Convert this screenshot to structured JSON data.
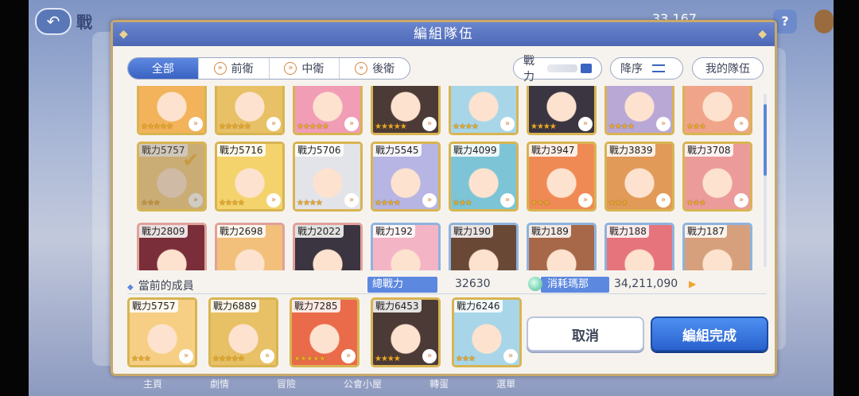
{
  "background": {
    "title": "戰",
    "power_display": "33,167",
    "help_label": "?",
    "menu_label": "",
    "bottom_nav": [
      "主頁",
      "劇情",
      "冒險",
      "公會小屋",
      "轉蛋",
      "選單"
    ]
  },
  "dialog": {
    "title": "編組隊伍",
    "tabs": [
      {
        "label": "全部",
        "active": true
      },
      {
        "label": "前衛",
        "active": false
      },
      {
        "label": "中衛",
        "active": false
      },
      {
        "label": "後衛",
        "active": false
      }
    ],
    "filter_power_label": "戰力",
    "sort_label": "降序",
    "my_team_label": "我的隊伍",
    "grid": {
      "row1": [
        {
          "name": "",
          "stars": "★★★★★",
          "rank": "»",
          "portrait": "#f2b35b"
        },
        {
          "name": "",
          "stars": "★★★★★",
          "rank": "»",
          "portrait": "#e8c065"
        },
        {
          "name": "",
          "stars": "★★★★★",
          "rank": "»",
          "portrait": "#f19db6"
        },
        {
          "name": "",
          "stars": "★★★★★",
          "rank": "»",
          "portrait": "#4b3a35"
        },
        {
          "name": "",
          "stars": "★★★★",
          "rank": "»",
          "portrait": "#a8d6e8"
        },
        {
          "name": "",
          "stars": "★★★★",
          "rank": "»",
          "portrait": "#3a3540"
        },
        {
          "name": "",
          "stars": "★★★★",
          "rank": "»",
          "portrait": "#b9a8d6"
        },
        {
          "name": "",
          "stars": "★★★",
          "rank": "»",
          "portrait": "#f0a58a"
        }
      ],
      "row2": [
        {
          "power": "戰力5757",
          "stars": "★★★",
          "rank": "»",
          "portrait": "#f6cf85",
          "selected": true
        },
        {
          "power": "戰力5716",
          "stars": "★★★★",
          "rank": "»",
          "portrait": "#f4d36c"
        },
        {
          "power": "戰力5706",
          "stars": "★★★★",
          "rank": "»",
          "portrait": "#e3e3ea"
        },
        {
          "power": "戰力5545",
          "stars": "★★★★",
          "rank": "»",
          "portrait": "#b7b5e3"
        },
        {
          "power": "戰力4099",
          "stars": "★★★",
          "rank": "»",
          "portrait": "#7dc5d6"
        },
        {
          "power": "戰力3947",
          "stars": "★★★",
          "rank": "»",
          "portrait": "#f08a55"
        },
        {
          "power": "戰力3839",
          "stars": "★★★",
          "rank": "»",
          "portrait": "#e19a58"
        },
        {
          "power": "戰力3708",
          "stars": "★★★",
          "rank": "»",
          "portrait": "#ec9b9b"
        }
      ],
      "row3": [
        {
          "power": "戰力2809",
          "stars": "",
          "rank": "",
          "portrait": "#7a2e3a"
        },
        {
          "power": "戰力2698",
          "stars": "",
          "rank": "",
          "portrait": "#f2c07a"
        },
        {
          "power": "戰力2022",
          "stars": "",
          "rank": "",
          "portrait": "#3a3540"
        },
        {
          "power": "戰力192",
          "stars": "",
          "rank": "",
          "portrait": "#f3b5c5"
        },
        {
          "power": "戰力190",
          "stars": "",
          "rank": "",
          "portrait": "#6a4836"
        },
        {
          "power": "戰力189",
          "stars": "",
          "rank": "",
          "portrait": "#a66848"
        },
        {
          "power": "戰力188",
          "stars": "",
          "rank": "",
          "portrait": "#e6747c"
        },
        {
          "power": "戰力187",
          "stars": "",
          "rank": "",
          "portrait": "#d7a07c"
        }
      ]
    },
    "current_members_label": "當前的成員",
    "total_power_label": "總戰力",
    "total_power_value": "32630",
    "mana_label": "消耗瑪那",
    "mana_value": "34,211,090",
    "mana_arrow": "▶",
    "members": [
      {
        "power": "戰力5757",
        "stars": "★★★",
        "rank": "»",
        "portrait": "#f6cf85"
      },
      {
        "power": "戰力6889",
        "stars": "★★★★★",
        "rank": "»",
        "portrait": "#e8c065"
      },
      {
        "power": "戰力7285",
        "stars": "★★★★★",
        "rank": "»",
        "portrait": "#ea6b4a"
      },
      {
        "power": "戰力6453",
        "stars": "★★★★",
        "rank": "»",
        "portrait": "#4b3a35"
      },
      {
        "power": "戰力6246",
        "stars": "★★★",
        "rank": "»",
        "portrait": "#a8d6e8"
      }
    ],
    "cancel_label": "取消",
    "confirm_label": "編組完成",
    "scroll_fraction": 0.1
  }
}
